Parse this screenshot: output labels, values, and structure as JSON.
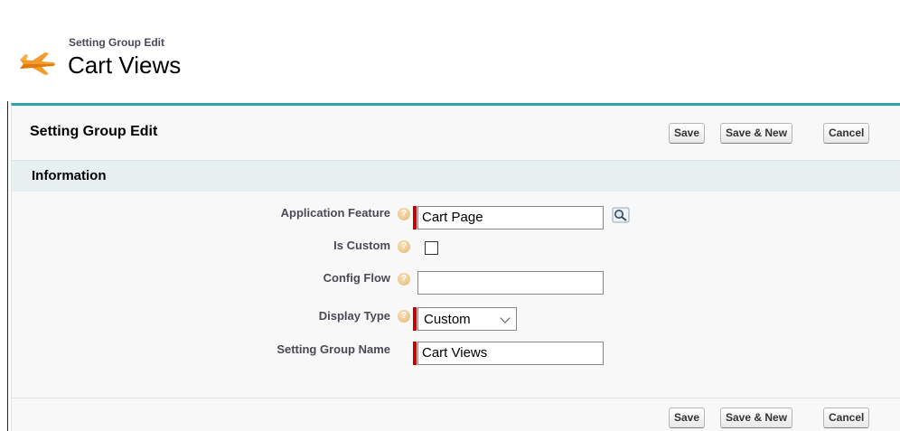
{
  "header": {
    "subtitle": "Setting Group Edit",
    "title": "Cart Views",
    "icon": "airplane-icon",
    "accent_color": "#2aa6a6"
  },
  "panel": {
    "title": "Setting Group Edit",
    "buttons": {
      "save": "Save",
      "save_new": "Save & New",
      "cancel": "Cancel"
    }
  },
  "section": {
    "title": "Information"
  },
  "form": {
    "application_feature": {
      "label": "Application Feature",
      "value": "Cart Page",
      "required": true
    },
    "is_custom": {
      "label": "Is Custom",
      "checked": false
    },
    "config_flow": {
      "label": "Config Flow",
      "value": ""
    },
    "display_type": {
      "label": "Display Type",
      "value": "Custom",
      "required": true
    },
    "setting_group_name": {
      "label": "Setting Group Name",
      "value": "Cart Views",
      "required": true
    }
  }
}
